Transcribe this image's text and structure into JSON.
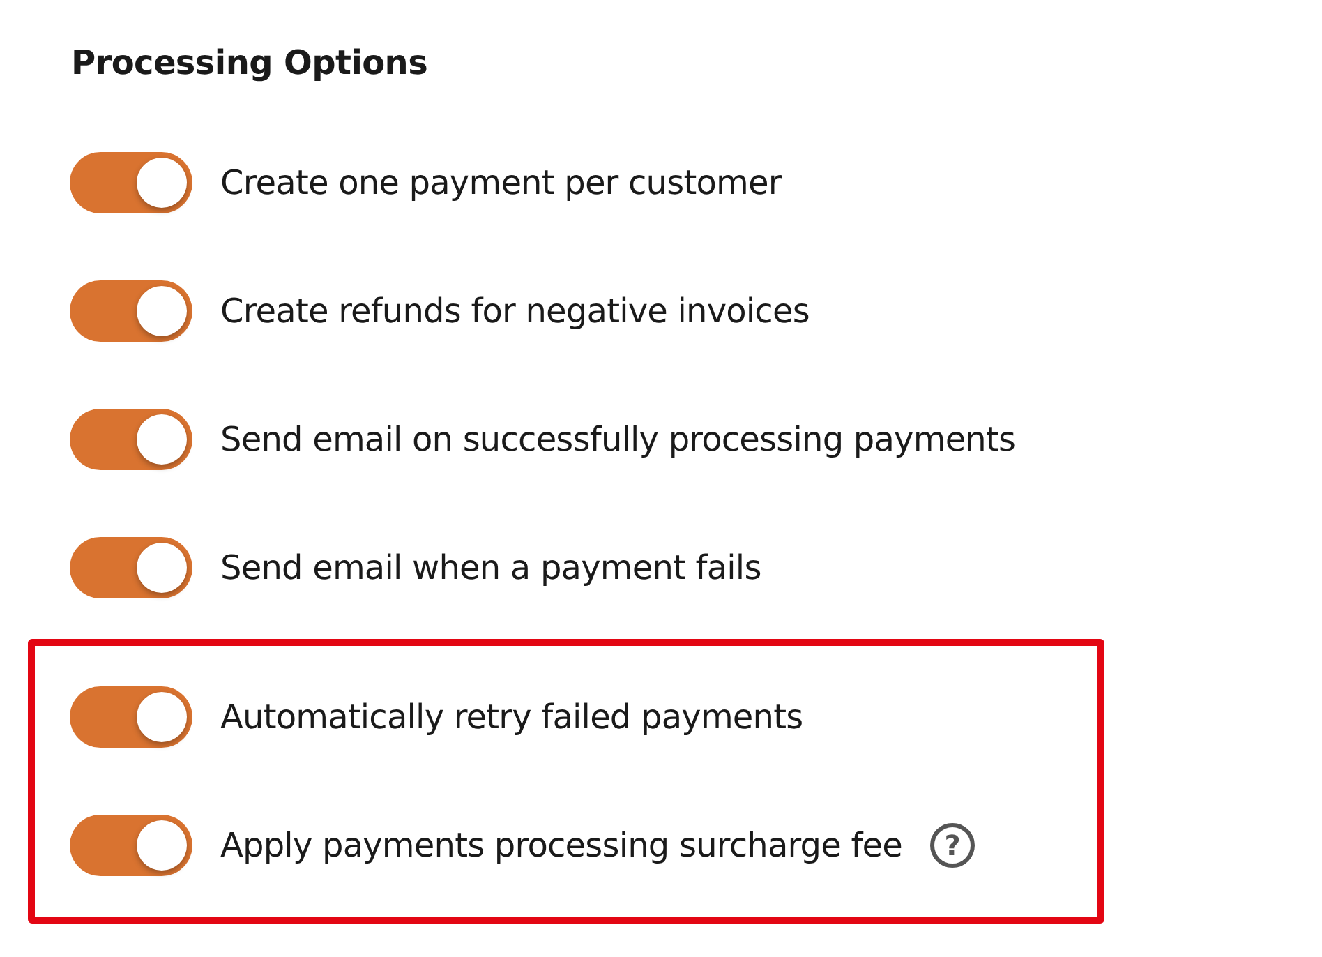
{
  "section": {
    "title": "Processing Options"
  },
  "options": [
    {
      "label": "Create one payment per customer",
      "on": true,
      "highlighted": false
    },
    {
      "label": "Create refunds for negative invoices",
      "on": true,
      "highlighted": false
    },
    {
      "label": "Send email on successfully processing payments",
      "on": true,
      "highlighted": false
    },
    {
      "label": "Send email when a payment fails",
      "on": true,
      "highlighted": false
    },
    {
      "label": "Automatically retry failed payments",
      "on": true,
      "highlighted": true
    },
    {
      "label": "Apply payments processing surcharge fee",
      "on": true,
      "highlighted": true,
      "help": "?"
    }
  ]
}
